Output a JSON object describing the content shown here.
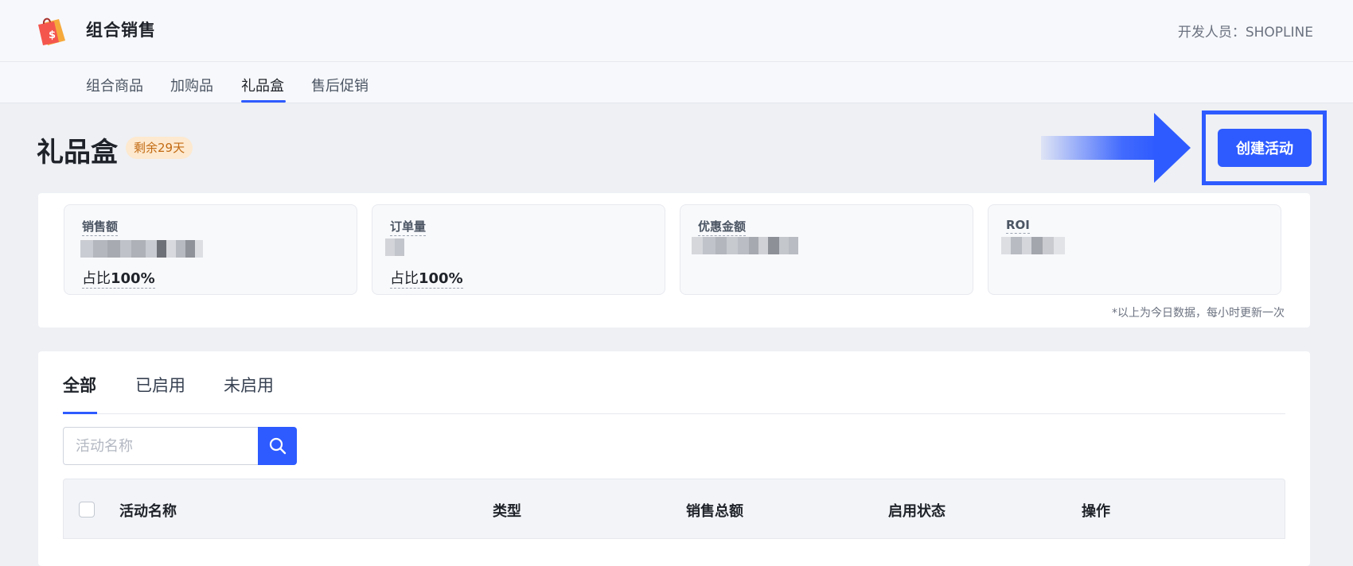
{
  "app": {
    "title": "组合销售",
    "developer": "开发人员：SHOPLINE"
  },
  "nav": {
    "tabs": [
      {
        "label": "组合商品"
      },
      {
        "label": "加购品"
      },
      {
        "label": "礼品盒"
      },
      {
        "label": "售后促销"
      }
    ],
    "active": "礼品盒"
  },
  "page": {
    "title": "礼品盒",
    "badge": "剩余29天",
    "create_button": "创建活动"
  },
  "stats": {
    "cards": [
      {
        "label": "销售额",
        "ratio_prefix": "占比",
        "ratio_value": "100%"
      },
      {
        "label": "订单量",
        "ratio_prefix": "占比",
        "ratio_value": "100%"
      },
      {
        "label": "优惠金额"
      },
      {
        "label": "ROI"
      }
    ],
    "note": "*以上为今日数据，每小时更新一次"
  },
  "list": {
    "tabs": [
      {
        "label": "全部"
      },
      {
        "label": "已启用"
      },
      {
        "label": "未启用"
      }
    ],
    "active_tab": "全部",
    "search": {
      "placeholder": "活动名称",
      "value": ""
    },
    "columns": [
      "活动名称",
      "类型",
      "销售总额",
      "启用状态",
      "操作"
    ]
  },
  "colors": {
    "accent": "#2e5bff",
    "badge_bg": "#fde9cf",
    "badge_text": "#c26a12"
  }
}
